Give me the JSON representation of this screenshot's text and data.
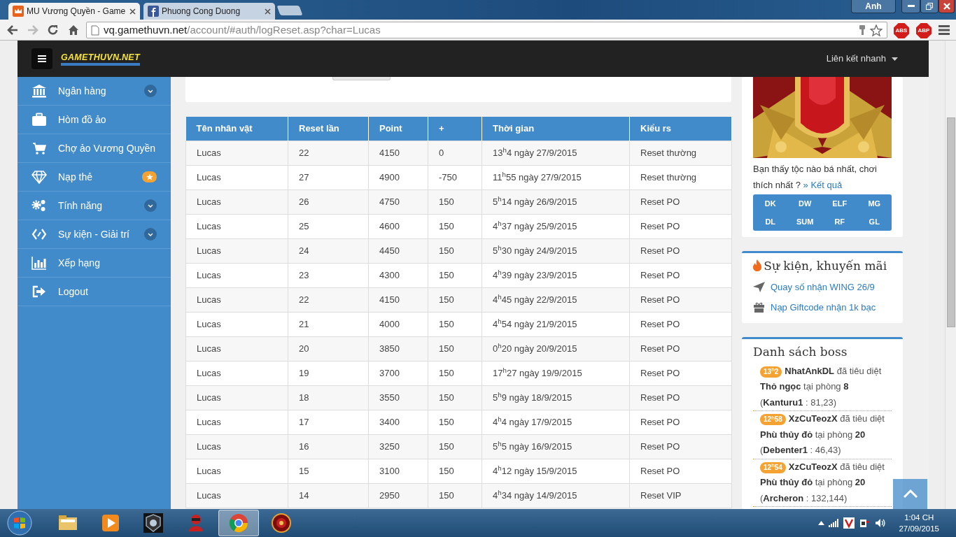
{
  "browser": {
    "tabs": [
      {
        "title": "MU Vương Quyền - Game",
        "selected": true
      },
      {
        "title": "Phuong Cong Duong",
        "selected": false
      }
    ],
    "user": "Anh",
    "url": {
      "host": "vq.gamethuvn.net",
      "path": "/account/#auth/logReset.asp?char=Lucas"
    },
    "extensions": [
      "ABS",
      "ABP"
    ]
  },
  "navbar": {
    "logo": "GAMETHUVN.NET",
    "quick_links": "Liên kết nhanh"
  },
  "sidebar": {
    "items": [
      {
        "label": "Ngân hàng",
        "kind": "dropdown"
      },
      {
        "label": "Hòm đồ ảo",
        "kind": "plain"
      },
      {
        "label": "Chợ ảo Vương Quyền",
        "kind": "plain"
      },
      {
        "label": "Nạp thẻ",
        "kind": "star"
      },
      {
        "label": "Tính năng",
        "kind": "dropdown"
      },
      {
        "label": "Sự kiện - Giải trí",
        "kind": "dropdown"
      },
      {
        "label": "Xếp hạng",
        "kind": "plain"
      },
      {
        "label": "Logout",
        "kind": "plain"
      }
    ]
  },
  "table": {
    "columns": [
      "Tên nhân vật",
      "Reset lần",
      "Point",
      "+",
      "Thời gian",
      "Kiểu rs"
    ],
    "rows": [
      [
        "Lucas",
        "22",
        "4150",
        "0",
        "13$^{h}$4 ngày 27/9/2015",
        "Reset thường"
      ],
      [
        "Lucas",
        "27",
        "4900",
        "-750",
        "11$^{h}$55 ngày 27/9/2015",
        "Reset thường"
      ],
      [
        "Lucas",
        "26",
        "4750",
        "150",
        "5$^{h}$14 ngày 26/9/2015",
        "Reset PO"
      ],
      [
        "Lucas",
        "25",
        "4600",
        "150",
        "4$^{h}$37 ngày 25/9/2015",
        "Reset PO"
      ],
      [
        "Lucas",
        "24",
        "4450",
        "150",
        "5$^{h}$30 ngày 24/9/2015",
        "Reset PO"
      ],
      [
        "Lucas",
        "23",
        "4300",
        "150",
        "4$^{h}$39 ngày 23/9/2015",
        "Reset PO"
      ],
      [
        "Lucas",
        "22",
        "4150",
        "150",
        "4$^{h}$45 ngày 22/9/2015",
        "Reset PO"
      ],
      [
        "Lucas",
        "21",
        "4000",
        "150",
        "4$^{h}$54 ngày 21/9/2015",
        "Reset PO"
      ],
      [
        "Lucas",
        "20",
        "3850",
        "150",
        "0$^{h}$20 ngày 20/9/2015",
        "Reset PO"
      ],
      [
        "Lucas",
        "19",
        "3700",
        "150",
        "17$^{h}$27 ngày 19/9/2015",
        "Reset PO"
      ],
      [
        "Lucas",
        "18",
        "3550",
        "150",
        "5$^{h}$9 ngày 18/9/2015",
        "Reset PO"
      ],
      [
        "Lucas",
        "17",
        "3400",
        "150",
        "4$^{h}$4 ngày 17/9/2015",
        "Reset PO"
      ],
      [
        "Lucas",
        "16",
        "3250",
        "150",
        "5$^{h}$5 ngày 16/9/2015",
        "Reset PO"
      ],
      [
        "Lucas",
        "15",
        "3100",
        "150",
        "4$^{h}$12 ngày 15/9/2015",
        "Reset PO"
      ],
      [
        "Lucas",
        "14",
        "2950",
        "150",
        "4$^{h}$34 ngày 14/9/2015",
        "Reset VIP"
      ]
    ]
  },
  "poll": {
    "question": "Bạn thấy tộc nào bá nhất, chơi thích nhất ?",
    "result_link": "» Kết quả",
    "classes": [
      "DK",
      "DW",
      "ELF",
      "MG",
      "DL",
      "SUM",
      "RF",
      "GL"
    ]
  },
  "promotions": {
    "title": "Sự kiện, khuyến mãi",
    "items": [
      {
        "label": "Quay số nhận WING 26/9",
        "kind": "plane"
      },
      {
        "label": "Nạp Giftcode nhận 1k bạc",
        "kind": "gift"
      }
    ]
  },
  "bosses": {
    "title": "Danh sách boss",
    "entries": [
      {
        "time": "13$^{h}$2",
        "text": "**NhatAnkDL** đã tiêu diệt **Thỏ ngọc** tại phòng **8** (**Kanturu1** : 81,23)"
      },
      {
        "time": "12$^{h}$58",
        "text": "**XzCuTeozX** đã tiêu diệt **Phù thủy đỏ** tại phòng **20** (**Debenter1** : 46,43)"
      },
      {
        "time": "12$^{h}$54",
        "text": "**XzCuTeozX** đã tiêu diệt **Phù thủy đỏ** tại phòng **20** (**Archeron** : 132,144)"
      }
    ]
  },
  "taskbar": {
    "apps": [
      {
        "kind": "folder",
        "selected": false
      },
      {
        "kind": "media",
        "selected": false
      },
      {
        "kind": "game",
        "selected": false
      },
      {
        "kind": "figure",
        "selected": false
      },
      {
        "kind": "chrome",
        "selected": true
      },
      {
        "kind": "game2",
        "selected": false
      }
    ],
    "time": "1:04 CH",
    "date": "27/09/2015"
  }
}
